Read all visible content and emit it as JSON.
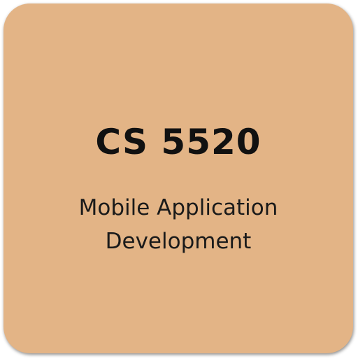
{
  "tile": {
    "background_color": "#e3b486",
    "course_code": "CS 5520",
    "course_title": "Mobile Application\nDevelopment"
  }
}
